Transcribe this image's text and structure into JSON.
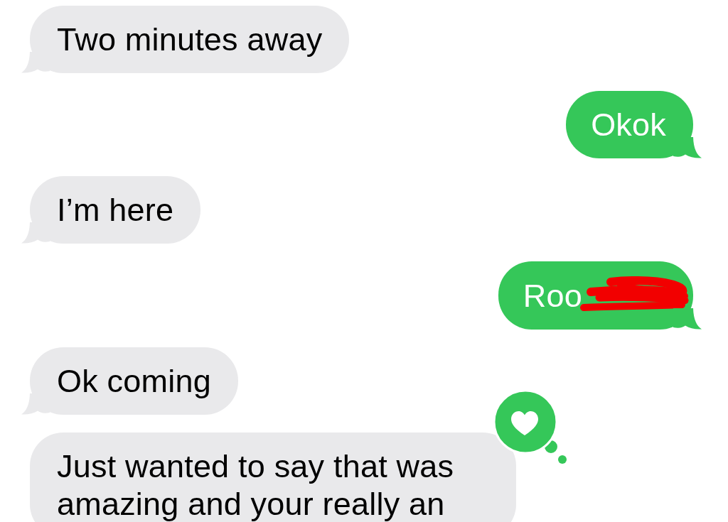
{
  "messages": [
    {
      "kind": "incoming",
      "text": "Two minutes away",
      "redacted": false,
      "tail": true
    },
    {
      "kind": "outgoing",
      "text": "Okok",
      "redacted": false,
      "tail": true
    },
    {
      "kind": "incoming",
      "text": "I’m here",
      "redacted": false,
      "tail": true
    },
    {
      "kind": "outgoing",
      "text": "Roo",
      "redacted": true,
      "tail": true
    },
    {
      "kind": "incoming",
      "text": "Ok coming",
      "redacted": false,
      "tail": true
    },
    {
      "kind": "incoming",
      "text": "Just wanted to say that was amazing and your really an",
      "redacted": false,
      "tail": false,
      "tapback": {
        "kind": "heart"
      }
    }
  ]
}
